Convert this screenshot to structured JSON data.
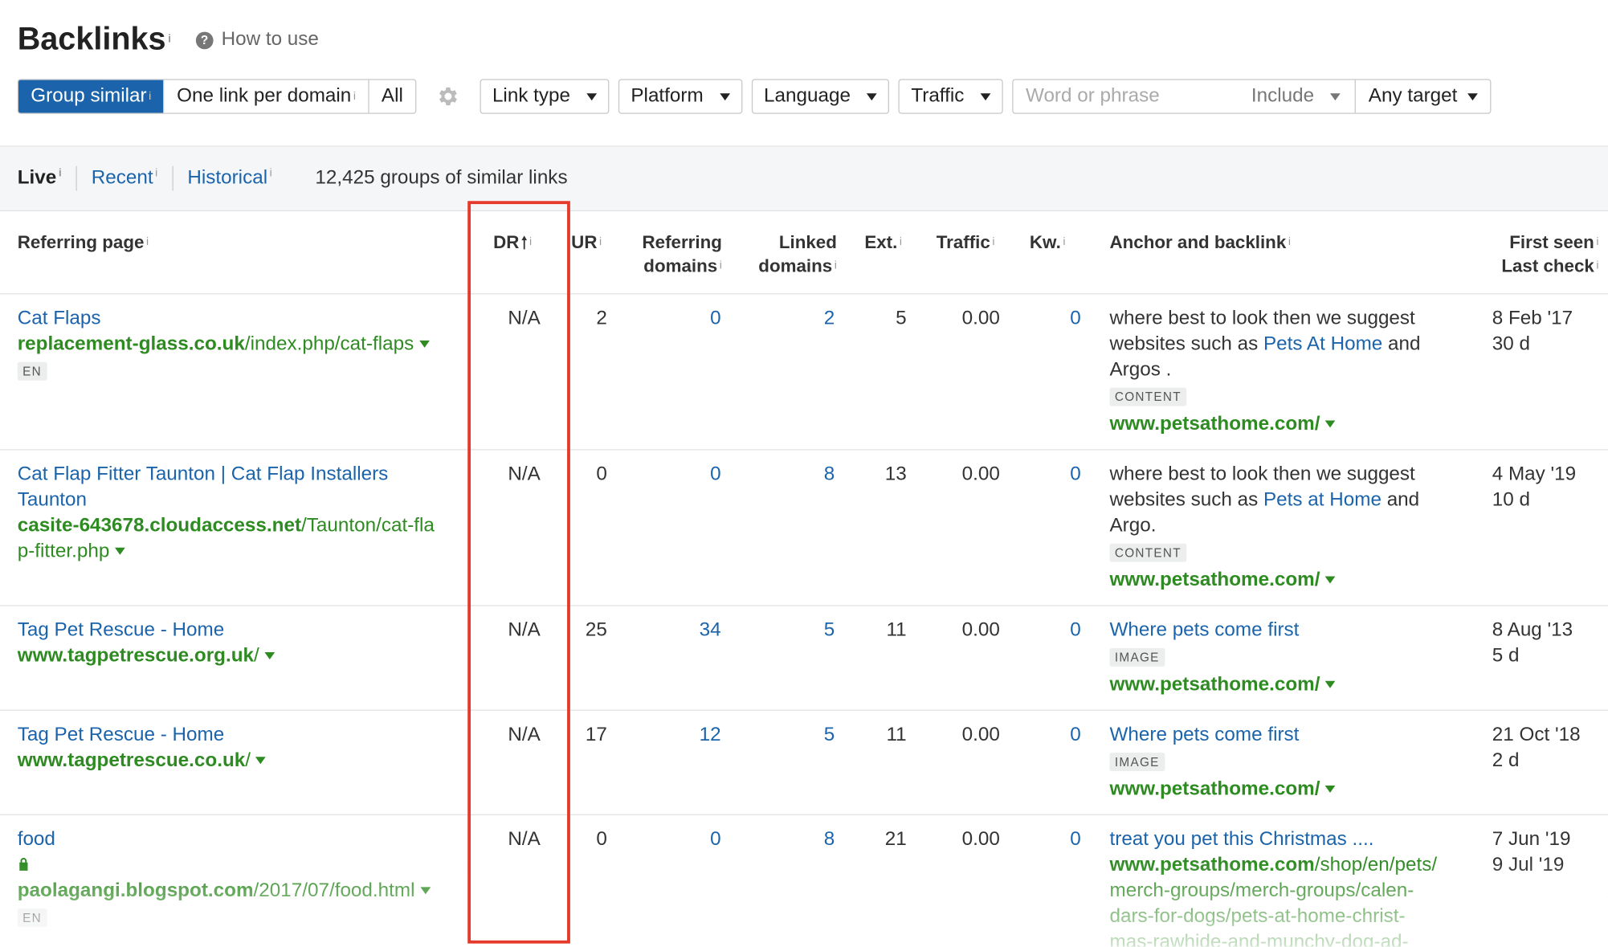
{
  "header": {
    "title": "Backlinks",
    "info": "i",
    "how_to_use": "How to use"
  },
  "toolbar": {
    "group_similar": "Group similar",
    "one_link_per_domain": "One link per domain",
    "all": "All",
    "link_type": "Link type",
    "platform": "Platform",
    "language": "Language",
    "traffic": "Traffic",
    "word_placeholder": "Word or phrase",
    "include": "Include",
    "any_target": "Any target"
  },
  "tabs": {
    "live": "Live",
    "recent": "Recent",
    "historical": "Historical",
    "groups_count": "12,425 groups of similar links"
  },
  "columns": {
    "referring_page": "Referring page",
    "dr": "DR",
    "ur": "UR",
    "referring_domains_1": "Referring",
    "referring_domains_2": "domains",
    "linked_domains_1": "Linked",
    "linked_domains_2": "domains",
    "ext": "Ext.",
    "traffic": "Traffic",
    "kw": "Kw.",
    "anchor": "Anchor and backlink",
    "first_seen": "First seen",
    "last_check": "Last check"
  },
  "rows": [
    {
      "title": "Cat Flaps",
      "title2": "",
      "domain": "replacement-glass.co.uk",
      "path": "/index.php/cat-flaps",
      "path2": "",
      "lang": "EN",
      "dr": "N/A",
      "ur": "2",
      "ref_domains": "0",
      "linked_domains": "2",
      "ext": "5",
      "traffic": "0.00",
      "kw": "0",
      "anchor_pre": "where best to look then we suggest websites such as ",
      "anchor_link": "Pets At Home",
      "anchor_post": " and Argos .",
      "type": "CONTENT",
      "backlink": "www.petsathome.com/",
      "first_seen": "8 Feb '17",
      "last_check": "30 d"
    },
    {
      "title": "Cat Flap Fitter Taunton | Cat Flap Installers",
      "title2": "Taunton",
      "domain": "casite-643678.cloudaccess.net",
      "path": "/Taunton/cat-fla",
      "path2": "p-fitter.php",
      "lang": "",
      "dr": "N/A",
      "ur": "0",
      "ref_domains": "0",
      "linked_domains": "8",
      "ext": "13",
      "traffic": "0.00",
      "kw": "0",
      "anchor_pre": "where best to look then we suggest websites such as ",
      "anchor_link": "Pets at Home",
      "anchor_post": " and Argo.",
      "type": "CONTENT",
      "backlink": "www.petsathome.com/",
      "first_seen": "4 May '19",
      "last_check": "10 d"
    },
    {
      "title": "Tag Pet Rescue - Home",
      "domain": "www.tagpetrescue.org.uk",
      "path": "/",
      "dr": "N/A",
      "ur": "25",
      "ref_domains": "34",
      "linked_domains": "5",
      "ext": "11",
      "traffic": "0.00",
      "kw": "0",
      "anchor_link": "Where pets come first",
      "type": "IMAGE",
      "backlink": "www.petsathome.com/",
      "first_seen": "8 Aug '13",
      "last_check": "5 d"
    },
    {
      "title": "Tag Pet Rescue - Home",
      "domain": "www.tagpetrescue.co.uk",
      "path": "/",
      "dr": "N/A",
      "ur": "17",
      "ref_domains": "12",
      "linked_domains": "5",
      "ext": "11",
      "traffic": "0.00",
      "kw": "0",
      "anchor_link": "Where pets come first",
      "type": "IMAGE",
      "backlink": "www.petsathome.com/",
      "first_seen": "21 Oct '18",
      "last_check": "2 d"
    },
    {
      "title": "food",
      "domain": "paolagangi.blogspot.com",
      "path": "/2017/07/food.html",
      "lang": "EN",
      "dr": "N/A",
      "ur": "0",
      "ref_domains": "0",
      "linked_domains": "8",
      "ext": "21",
      "traffic": "0.00",
      "kw": "0",
      "anchor_link": "treat you pet this Christmas ....",
      "backlink_domain": "www.petsathome.com",
      "backlink_path_1": "/shop/en/pets/",
      "backlink_path_2": "merch-groups/merch-groups/calen-",
      "backlink_path_3": "dars-for-dogs/pets-at-home-christ-",
      "backlink_path_4": "mas-rawhide-and-munchy-dog-ad-",
      "first_seen": "7 Jun '19",
      "last_check": "9 Jul '19"
    }
  ]
}
